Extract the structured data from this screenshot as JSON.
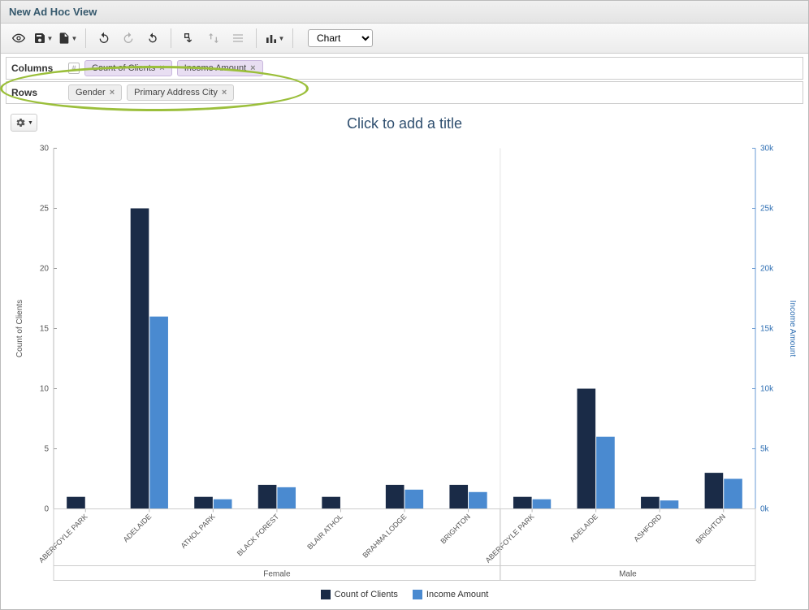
{
  "window_title": "New Ad Hoc View",
  "mode_select": {
    "value": "Chart",
    "options": [
      "Chart"
    ]
  },
  "shelves": {
    "columns": {
      "label": "Columns",
      "items": [
        "Count of Clients",
        "Income Amount"
      ]
    },
    "rows": {
      "label": "Rows",
      "items": [
        "Gender",
        "Primary Address City"
      ]
    }
  },
  "chart_title_placeholder": "Click to add a title",
  "legend": {
    "series1": "Count of Clients",
    "series2": "Income Amount"
  },
  "y1_axis_label": "Count of Clients",
  "y2_axis_label": "Income Amount",
  "y1_ticks": [
    "0",
    "5",
    "10",
    "15",
    "20",
    "25",
    "30"
  ],
  "y2_ticks": [
    "0k",
    "5k",
    "10k",
    "15k",
    "20k",
    "25k",
    "30k"
  ],
  "groups": {
    "g1": "Female",
    "g2": "Male"
  },
  "chart_data": {
    "type": "bar",
    "xlabel": "",
    "ylabel_left": "Count of Clients",
    "ylabel_right": "Income Amount",
    "ylim_left": [
      0,
      30
    ],
    "ylim_right": [
      0,
      30000
    ],
    "groups": [
      {
        "name": "Female",
        "categories": [
          "ABERFOYLE PARK",
          "ADELAIDE",
          "ATHOL PARK",
          "BLACK FOREST",
          "BLAIR ATHOL",
          "BRAHMA LODGE",
          "BRIGHTON"
        ],
        "series": [
          {
            "name": "Count of Clients",
            "values": [
              1,
              25,
              1,
              2,
              1,
              2,
              2
            ]
          },
          {
            "name": "Income Amount",
            "values": [
              0,
              16000,
              800,
              1800,
              0,
              1600,
              1400
            ]
          }
        ]
      },
      {
        "name": "Male",
        "categories": [
          "ABERFOYLE PARK",
          "ADELAIDE",
          "ASHFORD",
          "BRIGHTON"
        ],
        "series": [
          {
            "name": "Count of Clients",
            "values": [
              1,
              10,
              1,
              3
            ]
          },
          {
            "name": "Income Amount",
            "values": [
              800,
              6000,
              700,
              2500
            ]
          }
        ]
      }
    ],
    "colors": {
      "Count of Clients": "#1a2b47",
      "Income Amount": "#4a8ad0"
    }
  }
}
